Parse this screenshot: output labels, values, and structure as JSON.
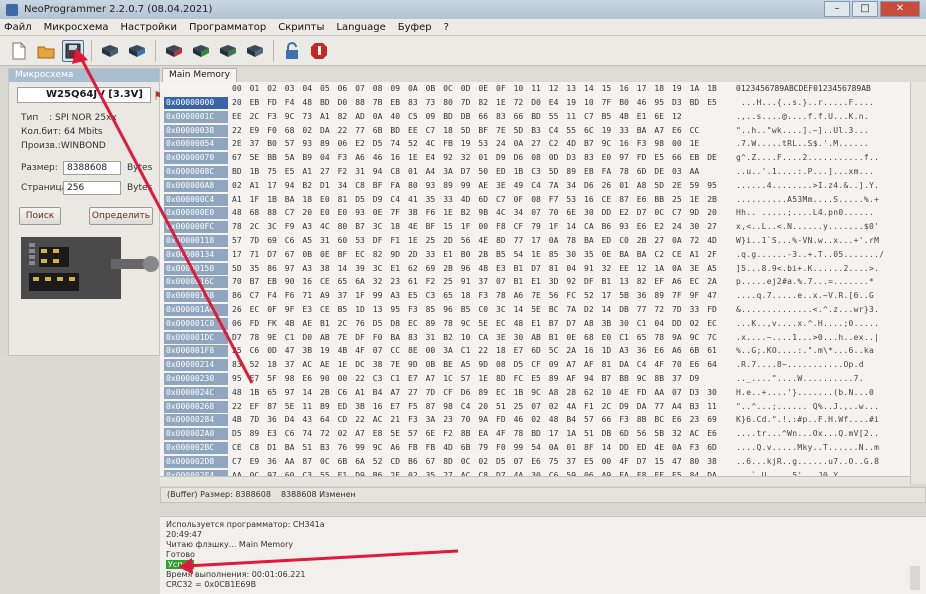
{
  "window": {
    "title": "NeoProgrammer 2.2.0.7 (08.04.2021)",
    "minimize": "–",
    "maximize": "□",
    "close": "✕"
  },
  "menu": [
    "Файл",
    "Микросхема",
    "Настройки",
    "Программатор",
    "Скрипты",
    "Language",
    "Буфер",
    "?"
  ],
  "toolbar": {
    "icons": [
      "new-file-icon",
      "open-folder-icon",
      "save-icon",
      "chip-read-icon",
      "chip-verify-icon",
      "chip-erase-icon",
      "chip-write-icon",
      "chip-check-icon",
      "chip-auto-icon",
      "lock-icon",
      "stop-icon"
    ]
  },
  "chip_panel": {
    "header": "Микросхема",
    "chip_name": "W25Q64JV [3.3V]",
    "type_label": "Тип",
    "type_value": ": SPI NOR 25xx",
    "size_label": "Кол.бит: 64 Mbits",
    "vendor_label": "Произв.:WINBOND",
    "size_field_label": "Размер:",
    "size_value": "8388608",
    "size_unit": "Bytes",
    "page_label": "Страница:",
    "page_value": "256",
    "page_unit": "Bytes",
    "search_button": "Поиск",
    "detect_button": "Определить"
  },
  "tabs": [
    "Main Memory"
  ],
  "hex": {
    "columns": [
      "00",
      "01",
      "02",
      "03",
      "04",
      "05",
      "06",
      "07",
      "08",
      "09",
      "0A",
      "0B",
      "0C",
      "0D",
      "0E",
      "0F",
      "10",
      "11",
      "12",
      "13",
      "14",
      "15",
      "16",
      "17",
      "18",
      "19",
      "1A",
      "1B"
    ],
    "ascii_header": "0123456789ABCDEF0123456789AB",
    "rows": [
      {
        "addr": "0x00000000",
        "bytes": "20 EB FD F4 48 BD D0 88 7B EB 83 73 80 7D 82 1E 72 D0 E4 19 10 7F B0 46 95 D3 BD E5",
        "ascii": " ...H...{..s.}..r.....F...."
      },
      {
        "addr": "0x0000001C",
        "bytes": "EE 2C F3 9C 73 A1 82 AD 0A 40 C5 09 BD DB 66 83 66 BD 55 11 C7 B5 4B E1 6E 12",
        "ascii": ".,..s....@....f.f.U...K.n."
      },
      {
        "addr": "0x00000038",
        "bytes": "22 E9 F0 68 02 DA 22 77 6B BD EE C7 18 5D BF 7E 5D B3 C4 55 6C 19 33 BA A7 E6 CC",
        "ascii": "\"..h..\"wk....].~]..Ul.3..."
      },
      {
        "addr": "0x00000054",
        "bytes": "2E 37 B0 57 93 89 06 E2 D5 74 52 4C FB 19 53 24 0A 27 C2 4D B7 9C 16 F3 98 00 1E",
        "ascii": ".7.W.....tRL..S$.'.M......"
      },
      {
        "addr": "0x00000070",
        "bytes": "67 5E BB 5A B9 04 F3 A6 46 16 1E E4 92 32 01 D9 D6 08 0D D3 83 E0 97 FD E5 66 EB DE",
        "ascii": "g^.Z....F....2...........f.."
      },
      {
        "addr": "0x0000008C",
        "bytes": "BD 1B 75 E5 A1 27 F2 31 94 C8 01 A4 3A D7 50 ED 1B C3 5D 89 EB FA 78 6D DE 03 AA",
        "ascii": "..u..'.1....:.P...]...xm..."
      },
      {
        "addr": "0x000000A8",
        "bytes": "02 A1 17 94 B2 D1 34 C8 BF FA 80 93 89 99 AE 3E 49 C4 7A 34 D6 26 01 A8 5D 2E 59 95",
        "ascii": "......4........>I.z4.&..].Y."
      },
      {
        "addr": "0x000000C4",
        "bytes": "A1 1F 1B BA 18 E0 81 D5 D9 C4 41 35 33 4D 6D C7 0F 08 F7 53 16 CE 87 E6 BB 25 1E 2B",
        "ascii": "..........A53Mm....S.....%.+"
      },
      {
        "addr": "0x000000E0",
        "bytes": "48 68 88 C7 20 E0 E0 93 0E 7F 3B F6 1E B2 9B 4C 34 07 70 6E 30 DD E2 D7 0C C7 9D 20",
        "ascii": "Hh.. .....;....L4.pn0......"
      },
      {
        "addr": "0x000000FC",
        "bytes": "78 2C 3C F9 A3 4C 80 B7 3C 18 4E BF 15 1F 00 F8 CF 79 1F 14 CA B6 93 E6 E2 24 30 27",
        "ascii": "x,<..L..<.N......y.......$0'"
      },
      {
        "addr": "0x00000118",
        "bytes": "57 7D 69 C6 A5 31 60 53 DF F1 1E 25 2D 56 4E 8D 77 17 0A 78 BA ED C0 2B 27 0A 72 4D",
        "ascii": "W}i..1`S...%-VN.w..x...+'.rM"
      },
      {
        "addr": "0x00000134",
        "bytes": "17 71 D7 67 0B 0E BF EC 82 9D 2D 33 E1 B0 2B B5 54 1E 85 30 35 0E BA BA C2 CE A1 2F",
        "ascii": ".q.g......-3..+.T..05......./"
      },
      {
        "addr": "0x00000150",
        "bytes": "5D 35 86 97 A3 38 14 39 3C E1 62 69 2B 96 4B E3 B1 D7 81 04 91 32 EE 12 1A 0A 3E A5",
        "ascii": "]5...8.9<.bi+.K......2....>."
      },
      {
        "addr": "0x0000016C",
        "bytes": "70 B7 EB 90 16 CE 65 6A 32 23 61 F2 25 91 37 07 B1 E1 3D 92 DF B1 13 82 EF A6 EC 2A",
        "ascii": "p.....ej2#a.%.7...=.......*"
      },
      {
        "addr": "0x00000188",
        "bytes": "86 C7 F4 F6 71 A9 37 1F 99 A3 E5 C3 65 18 F3 78 A6 7E 56 FC 52 17 5B 36 89 7F 9F 47",
        "ascii": "....q.7.....e..x.~V.R.[6..G"
      },
      {
        "addr": "0x000001A4",
        "bytes": "26 EC 0F 9F E3 CE B5 1D 13 95 F3 85 96 B5 C0 3C 14 5E BC 7A D2 14 DB 77 72 7D 33 FD",
        "ascii": "&..............<.^.z...wr}3."
      },
      {
        "addr": "0x000001C0",
        "bytes": "06 FD FK 4B AE B1 2C 76 D5 D8 EC 89 78 9C 5E EC 48 E1 B7 D7 A8 3B 30 C1 04 DD 02 EC",
        "ascii": "...K..,v....x.^.H....;0....."
      },
      {
        "addr": "0x000001DC",
        "bytes": "D7 78 9E C1 D0 AB 7E DF F0 BA 83 31 B2 10 CA 3E 30 AB B1 0E 68 E0 C1 65 78 9A 9C 7C",
        "ascii": ".x....~....1...>0...h..ex..|"
      },
      {
        "addr": "0x000001F8",
        "bytes": "25 C6 0D 47 3B 19 4B 4F 07 CC 8E 00 3A C1 22 18 E7 6D 5C 2A 16 1D A3 36 E6 A6 6B 61",
        "ascii": "%..G;.KO....:.\".m\\*...6..ka"
      },
      {
        "addr": "0x00000214",
        "bytes": "83 52 18 37 AC AE 1E DC 38 7E 9D 0B BE A5 9D 08 D5 CF 09 A7 AF 81 DA C4 4F 70 E6 64",
        "ascii": ".R.7....8~...........Op.d"
      },
      {
        "addr": "0x00000230",
        "bytes": "95 E7 5F 98 E6 90 00 22 C3 C1 E7 A7 1C 57 1E 8D FC E5 89 AF 94 B7 BB 9C 8B 37 D9",
        "ascii": ".._....\"....W..........7."
      },
      {
        "addr": "0x0000024C",
        "bytes": "48 1B 65 97 14 2B C6 A1 B4 A7 27 7D CF D6 89 EC 1B 9C A8 28 62 10 4E FD AA 07 D3 30",
        "ascii": "H.e..+....'}.......(b.N...0"
      },
      {
        "addr": "0x00000268",
        "bytes": "22 EF 87 5E 11 B9 ED 3B 16 E7 F5 87 98 C4 20 51 25 07 02 4A F1 2C D9 DA 77 A4 B3 11",
        "ascii": "\"..^...;...... Q%..J.,..w..."
      },
      {
        "addr": "0x00000284",
        "bytes": "4B 7D 36 D4 43 64 CD 22 AC 21 F3 3A 23 70 9A FD 46 02 48 B4 57 66 F3 8B BC E6 23 69",
        "ascii": "K}6.Cd.\".!.:#p..F.H.Wf....#i"
      },
      {
        "addr": "0x000002A0",
        "bytes": "D5 89 E3 C6 74 72 02 A7 E8 5E 57 6E F2 8B EA 4F 78 BD 17 1A 51 DB 6D 56 5B 32 AC E6",
        "ascii": "....tr...^Wn...Ox...Q.mV[2.."
      },
      {
        "addr": "0x000002BC",
        "bytes": "CE C8 D1 BA 51 B3 76 99 9C A6 FB FB 4D 6B 79 F0 99 54 0A 01 8F 14 DD ED 4E 0A F3 6D",
        "ascii": "....Q.v.....Mky..T......N..m"
      },
      {
        "addr": "0x000002D8",
        "bytes": "C7 E9 36 AA 87 0C 6B 6A 52 CD B6 67 8D 0C 02 D5 07 E6 75 37 E5 00 4F D7 15 47 80 38",
        "ascii": "..6...kjR..g......u7..O..G.8"
      },
      {
        "addr": "0x000002F4",
        "bytes": "AA 0C 97 60 C3 55 E1 D9 B6 2E 02 35 27 AC C8 D7 4A 30 C6 59 06 A9 EA F8 FF E5 84 DA",
        "ascii": "...`.U.....5'...J0.Y......."
      }
    ]
  },
  "statusbar": {
    "buffer_size": "(Buffer) Размер: 8388608",
    "changed": "8388608 Изменен"
  },
  "log": [
    "Используется программатор: CH341a",
    "20:49:47",
    "Читаю флэшку... Main Memory",
    "Готово",
    "Успех",
    "Время выполнения: 00:01:06.221",
    "CRC32 = 0x0CB1E69B"
  ],
  "colors": {
    "annotation_arrow": "#e01a3a",
    "success_highlight": "#2fa02f",
    "address_selected": "#3a64a8"
  }
}
